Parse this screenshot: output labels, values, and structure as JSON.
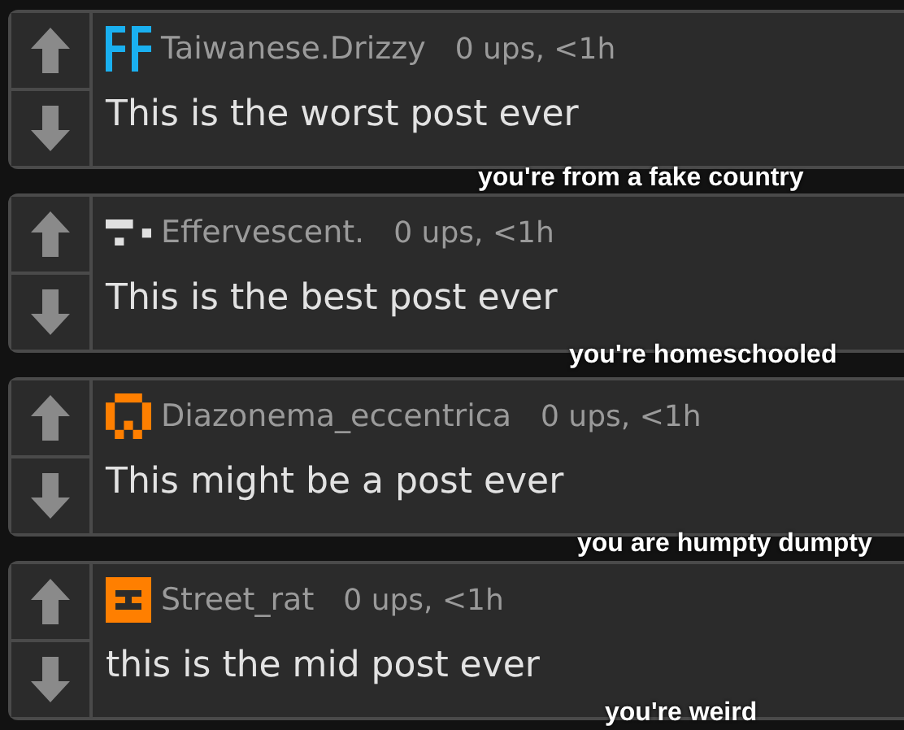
{
  "comments": [
    {
      "username": "Taiwanese.Drizzy",
      "meta": "0 ups, <1h",
      "text": "This is the worst post ever",
      "reply": "you're from a fake country",
      "color": "#1ab0f0"
    },
    {
      "username": "Effervescent.",
      "meta": "0 ups, <1h",
      "text": "This is the best post ever",
      "reply": "you're homeschooled",
      "color": "#e0e0e0"
    },
    {
      "username": "Diazonema_eccentrica",
      "meta": "0 ups, <1h",
      "text": "This might be a post ever",
      "reply": "you are humpty dumpty",
      "color": "#ff7f00"
    },
    {
      "username": "Street_rat",
      "meta": "0 ups, <1h",
      "text": "this is the mid post ever",
      "reply": "you're weird",
      "color": "#ff7f00"
    }
  ]
}
